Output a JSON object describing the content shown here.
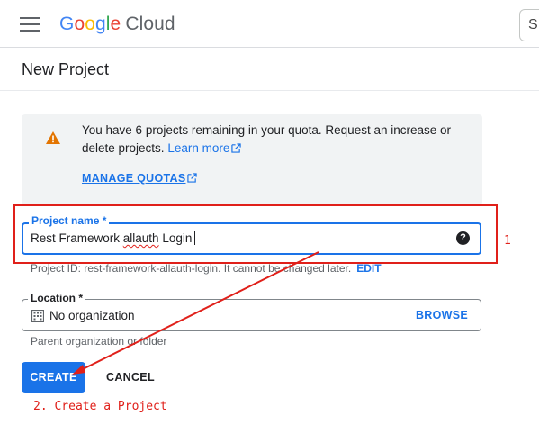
{
  "header": {
    "logo_google": [
      "G",
      "o",
      "o",
      "g",
      "l",
      "e"
    ],
    "logo_product": "Cloud",
    "search_stub": "S"
  },
  "page": {
    "title": "New Project"
  },
  "quota_notice": {
    "message": "You have 6 projects remaining in your quota. Request an increase or delete projects.",
    "learn_more": "Learn more",
    "manage_quotas": "MANAGE QUOTAS"
  },
  "form": {
    "project_name": {
      "label": "Project name *",
      "value_before": "Rest Framework ",
      "value_misspelled": "allauth",
      "value_after": " Login",
      "help": "?"
    },
    "project_id": {
      "text": "Project ID: rest-framework-allauth-login. It cannot be changed later.",
      "edit": "EDIT"
    },
    "location": {
      "label": "Location *",
      "value": "No organization",
      "browse": "BROWSE",
      "hint": "Parent organization or folder"
    },
    "actions": {
      "create": "CREATE",
      "cancel": "CANCEL"
    }
  },
  "annotations": {
    "step_1": "1",
    "step_2": "2. Create a Project",
    "color": "#e0201a"
  },
  "colors": {
    "accent": "#1a73e8",
    "warning": "#e37400"
  }
}
